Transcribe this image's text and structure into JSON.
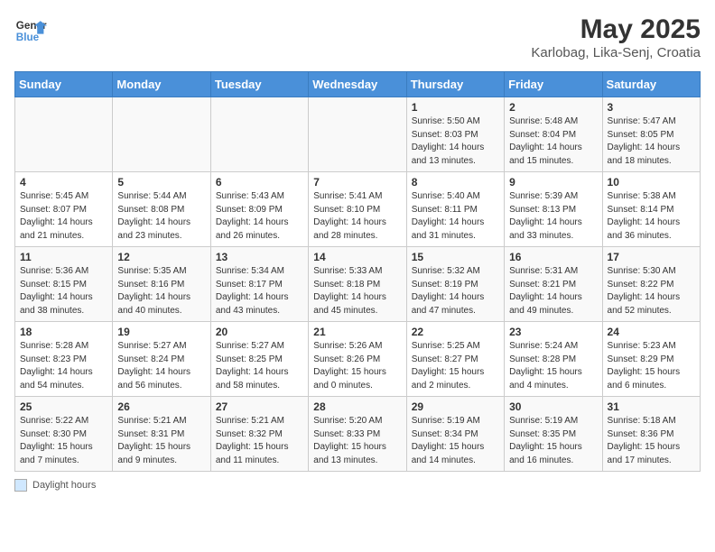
{
  "header": {
    "logo_line1": "General",
    "logo_line2": "Blue",
    "title": "May 2025",
    "subtitle": "Karlobag, Lika-Senj, Croatia"
  },
  "days_of_week": [
    "Sunday",
    "Monday",
    "Tuesday",
    "Wednesday",
    "Thursday",
    "Friday",
    "Saturday"
  ],
  "weeks": [
    [
      {
        "day": "",
        "info": ""
      },
      {
        "day": "",
        "info": ""
      },
      {
        "day": "",
        "info": ""
      },
      {
        "day": "",
        "info": ""
      },
      {
        "day": "1",
        "info": "Sunrise: 5:50 AM\nSunset: 8:03 PM\nDaylight: 14 hours\nand 13 minutes."
      },
      {
        "day": "2",
        "info": "Sunrise: 5:48 AM\nSunset: 8:04 PM\nDaylight: 14 hours\nand 15 minutes."
      },
      {
        "day": "3",
        "info": "Sunrise: 5:47 AM\nSunset: 8:05 PM\nDaylight: 14 hours\nand 18 minutes."
      }
    ],
    [
      {
        "day": "4",
        "info": "Sunrise: 5:45 AM\nSunset: 8:07 PM\nDaylight: 14 hours\nand 21 minutes."
      },
      {
        "day": "5",
        "info": "Sunrise: 5:44 AM\nSunset: 8:08 PM\nDaylight: 14 hours\nand 23 minutes."
      },
      {
        "day": "6",
        "info": "Sunrise: 5:43 AM\nSunset: 8:09 PM\nDaylight: 14 hours\nand 26 minutes."
      },
      {
        "day": "7",
        "info": "Sunrise: 5:41 AM\nSunset: 8:10 PM\nDaylight: 14 hours\nand 28 minutes."
      },
      {
        "day": "8",
        "info": "Sunrise: 5:40 AM\nSunset: 8:11 PM\nDaylight: 14 hours\nand 31 minutes."
      },
      {
        "day": "9",
        "info": "Sunrise: 5:39 AM\nSunset: 8:13 PM\nDaylight: 14 hours\nand 33 minutes."
      },
      {
        "day": "10",
        "info": "Sunrise: 5:38 AM\nSunset: 8:14 PM\nDaylight: 14 hours\nand 36 minutes."
      }
    ],
    [
      {
        "day": "11",
        "info": "Sunrise: 5:36 AM\nSunset: 8:15 PM\nDaylight: 14 hours\nand 38 minutes."
      },
      {
        "day": "12",
        "info": "Sunrise: 5:35 AM\nSunset: 8:16 PM\nDaylight: 14 hours\nand 40 minutes."
      },
      {
        "day": "13",
        "info": "Sunrise: 5:34 AM\nSunset: 8:17 PM\nDaylight: 14 hours\nand 43 minutes."
      },
      {
        "day": "14",
        "info": "Sunrise: 5:33 AM\nSunset: 8:18 PM\nDaylight: 14 hours\nand 45 minutes."
      },
      {
        "day": "15",
        "info": "Sunrise: 5:32 AM\nSunset: 8:19 PM\nDaylight: 14 hours\nand 47 minutes."
      },
      {
        "day": "16",
        "info": "Sunrise: 5:31 AM\nSunset: 8:21 PM\nDaylight: 14 hours\nand 49 minutes."
      },
      {
        "day": "17",
        "info": "Sunrise: 5:30 AM\nSunset: 8:22 PM\nDaylight: 14 hours\nand 52 minutes."
      }
    ],
    [
      {
        "day": "18",
        "info": "Sunrise: 5:28 AM\nSunset: 8:23 PM\nDaylight: 14 hours\nand 54 minutes."
      },
      {
        "day": "19",
        "info": "Sunrise: 5:27 AM\nSunset: 8:24 PM\nDaylight: 14 hours\nand 56 minutes."
      },
      {
        "day": "20",
        "info": "Sunrise: 5:27 AM\nSunset: 8:25 PM\nDaylight: 14 hours\nand 58 minutes."
      },
      {
        "day": "21",
        "info": "Sunrise: 5:26 AM\nSunset: 8:26 PM\nDaylight: 15 hours\nand 0 minutes."
      },
      {
        "day": "22",
        "info": "Sunrise: 5:25 AM\nSunset: 8:27 PM\nDaylight: 15 hours\nand 2 minutes."
      },
      {
        "day": "23",
        "info": "Sunrise: 5:24 AM\nSunset: 8:28 PM\nDaylight: 15 hours\nand 4 minutes."
      },
      {
        "day": "24",
        "info": "Sunrise: 5:23 AM\nSunset: 8:29 PM\nDaylight: 15 hours\nand 6 minutes."
      }
    ],
    [
      {
        "day": "25",
        "info": "Sunrise: 5:22 AM\nSunset: 8:30 PM\nDaylight: 15 hours\nand 7 minutes."
      },
      {
        "day": "26",
        "info": "Sunrise: 5:21 AM\nSunset: 8:31 PM\nDaylight: 15 hours\nand 9 minutes."
      },
      {
        "day": "27",
        "info": "Sunrise: 5:21 AM\nSunset: 8:32 PM\nDaylight: 15 hours\nand 11 minutes."
      },
      {
        "day": "28",
        "info": "Sunrise: 5:20 AM\nSunset: 8:33 PM\nDaylight: 15 hours\nand 13 minutes."
      },
      {
        "day": "29",
        "info": "Sunrise: 5:19 AM\nSunset: 8:34 PM\nDaylight: 15 hours\nand 14 minutes."
      },
      {
        "day": "30",
        "info": "Sunrise: 5:19 AM\nSunset: 8:35 PM\nDaylight: 15 hours\nand 16 minutes."
      },
      {
        "day": "31",
        "info": "Sunrise: 5:18 AM\nSunset: 8:36 PM\nDaylight: 15 hours\nand 17 minutes."
      }
    ]
  ],
  "legend": {
    "color_label": "Daylight hours",
    "color_hex": "#d0e8ff"
  }
}
